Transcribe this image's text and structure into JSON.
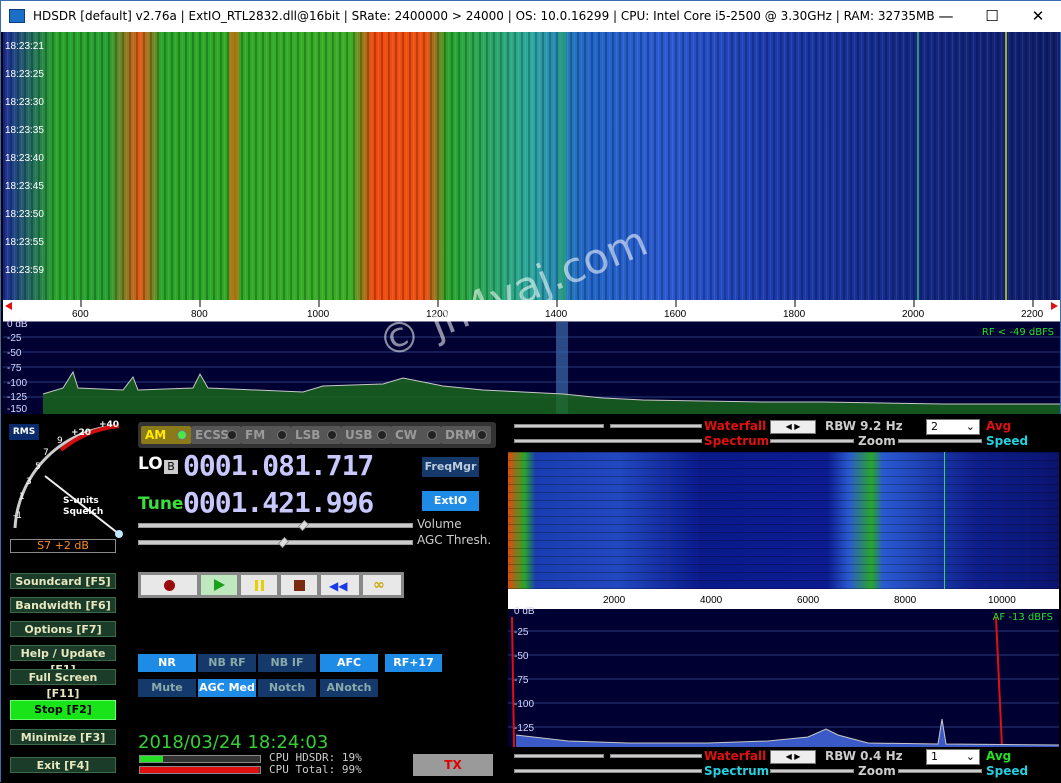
{
  "titlebar": {
    "title": "HDSDR  [default]  v2.76a  |  ExtIO_RTL2832.dll@16bit  |  SRate: 2400000 > 24000  |  OS: 10.0.16299    |  CPU: Intel Core i5-2500 @ 3.30GHz  |  RAM: 32735MB",
    "minimize": "—",
    "maximize": "☐",
    "close": "✕"
  },
  "waterfall": {
    "times": [
      "18:23:21",
      "18:23:25",
      "18:23:30",
      "18:23:35",
      "18:23:40",
      "18:23:45",
      "18:23:50",
      "18:23:55",
      "18:23:59"
    ],
    "freq_ticks": [
      "600",
      "800",
      "1000",
      "1200",
      "1400",
      "1600",
      "1800",
      "2000",
      "2200"
    ]
  },
  "spectrum": {
    "db_labels": [
      "0 dB",
      "-25",
      "-50",
      "-75",
      "-100",
      "-125",
      "-150"
    ],
    "rf_level": "RF < -49 dBFS"
  },
  "meter": {
    "rms": "RMS",
    "scale": [
      "-1",
      "1",
      "3",
      "5",
      "7",
      "9",
      "+20",
      "+40"
    ],
    "s_units": "S-units",
    "squelch": "Squelch",
    "value": "S7 +2 dB"
  },
  "side_buttons": [
    {
      "label": "Soundcard  [F5]"
    },
    {
      "label": "Bandwidth  [F6]"
    },
    {
      "label": "Options    [F7]"
    },
    {
      "label": "Help / Update  [F1]"
    },
    {
      "label": "Full Screen  [F11]"
    },
    {
      "label": "Stop        [F2]"
    },
    {
      "label": "Minimize  [F3]"
    },
    {
      "label": "Exit        [F4]"
    }
  ],
  "modes": [
    "AM",
    "ECSS",
    "FM",
    "LSB",
    "USB",
    "CW",
    "DRM"
  ],
  "lo": {
    "label": "LO",
    "bank": "B",
    "value": "0001.081.717"
  },
  "tune": {
    "label": "Tune",
    "value": "0001.421.996"
  },
  "buttons": {
    "freqmgr": "FreqMgr",
    "extio": "ExtIO",
    "tx": "TX"
  },
  "sliders": {
    "volume": "Volume",
    "agc": "AGC Thresh."
  },
  "dsp": [
    "NR",
    "NB RF",
    "NB IF",
    "AFC",
    "RF+17",
    "Mute",
    "AGC Med",
    "Notch",
    "ANotch"
  ],
  "status": {
    "datetime": "2018/03/24 18:24:03",
    "cpu_hdsdr": "CPU HDSDR:  19%",
    "cpu_total": "CPU Total:  99%",
    "cpu_hdsdr_fraction": 0.19,
    "cpu_total_fraction": 0.99
  },
  "right_top": {
    "waterfall": "Waterfall",
    "spectrum": "Spectrum",
    "rbw": "RBW  9.2 Hz",
    "zoom": "Zoom",
    "avg_select": "2",
    "avg": "Avg",
    "speed": "Speed"
  },
  "af": {
    "freq_ticks": [
      "2000",
      "4000",
      "6000",
      "8000",
      "10000"
    ],
    "db_labels": [
      "0 dB",
      "-25",
      "-50",
      "-75",
      "-100",
      "-125"
    ],
    "af_level": "AF -13 dBFS"
  },
  "right_bottom": {
    "waterfall": "Waterfall",
    "spectrum": "Spectrum",
    "rbw": "RBW  0.4 Hz",
    "zoom": "Zoom",
    "avg_select": "1",
    "avg": "Avg",
    "speed": "Speed"
  },
  "watermark": "© jh4vaj.com",
  "colors": {
    "waterfall_green": "#2aa62a",
    "waterfall_red": "#f04a10",
    "waterfall_blue": "#1c3cb0",
    "accent_blue": "#1e8ce6"
  }
}
